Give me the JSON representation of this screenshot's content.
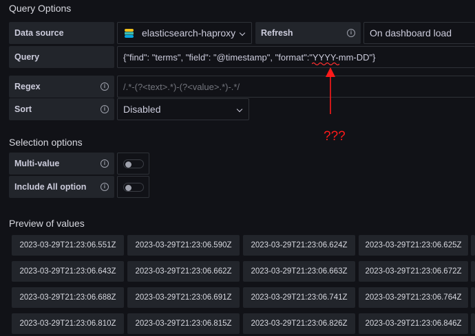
{
  "query_options": {
    "title": "Query Options",
    "data_source": {
      "label": "Data source",
      "value": "elasticsearch-haproxy",
      "logo_icon": "elasticsearch-icon"
    },
    "refresh": {
      "label": "Refresh",
      "value": "On dashboard load"
    },
    "query": {
      "label": "Query",
      "value": "{\"find\": \"terms\", \"field\": \"@timestamp\", \"format\":\"YYYY-mm-DD\"}"
    },
    "regex": {
      "label": "Regex",
      "placeholder": "/.*-(?<text>.*)-(?<value>.*)-.*/"
    },
    "sort": {
      "label": "Sort",
      "value": "Disabled"
    }
  },
  "selection_options": {
    "title": "Selection options",
    "multi_value": {
      "label": "Multi-value",
      "enabled": false
    },
    "include_all": {
      "label": "Include All option",
      "enabled": false
    }
  },
  "preview": {
    "title": "Preview of values",
    "values": [
      "2023-03-29T21:23:06.551Z",
      "2023-03-29T21:23:06.590Z",
      "2023-03-29T21:23:06.624Z",
      "2023-03-29T21:23:06.625Z",
      "2023-03-29T21:23:06.643Z",
      "2023-03-29T21:23:06.662Z",
      "2023-03-29T21:23:06.663Z",
      "2023-03-29T21:23:06.672Z",
      "2023-03-29T21:23:06.688Z",
      "2023-03-29T21:23:06.691Z",
      "2023-03-29T21:23:06.741Z",
      "2023-03-29T21:23:06.764Z",
      "2023-03-29T21:23:06.810Z",
      "2023-03-29T21:23:06.815Z",
      "2023-03-29T21:23:06.826Z",
      "2023-03-29T21:23:06.846Z"
    ]
  },
  "annotation": {
    "text": "???",
    "color": "#ff1a1a"
  },
  "colors": {
    "background": "#111217",
    "label_bg": "#22252b",
    "border": "#2f3238",
    "text": "#ccccdc"
  }
}
